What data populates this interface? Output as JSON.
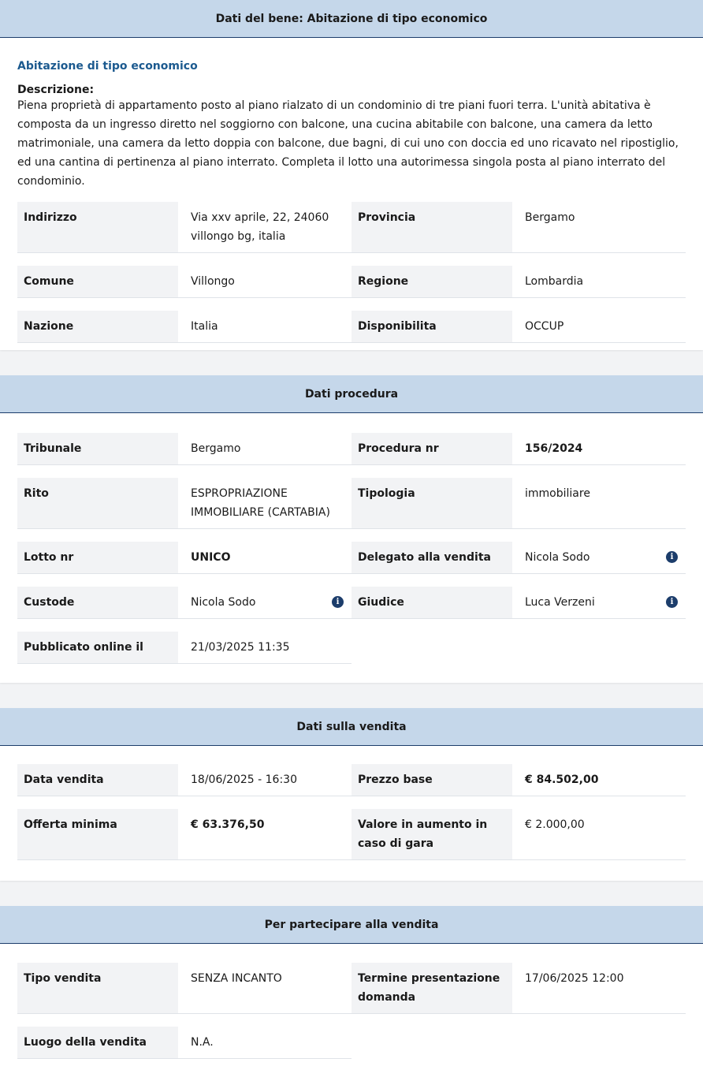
{
  "bene": {
    "header": "Dati del bene: Abitazione di tipo economico",
    "subtitle": "Abitazione di tipo economico",
    "descrizione_label": "Descrizione:",
    "descrizione": "Piena proprietà di appartamento posto al piano rialzato di un condominio di tre piani fuori terra. L'unità abitativa è composta da un ingresso diretto nel soggiorno con balcone, una cucina abitabile con balcone, una camera da letto matrimoniale, una camera da letto doppia con balcone, due bagni, di cui uno con doccia ed uno ricavato nel ripostiglio, ed una cantina di pertinenza al piano interrato. Completa il lotto una autorimessa singola posta al piano interrato del condominio.",
    "indirizzo_label": "Indirizzo",
    "indirizzo": "Via xxv aprile, 22, 24060 villongo bg, italia",
    "provincia_label": "Provincia",
    "provincia": "Bergamo",
    "comune_label": "Comune",
    "comune": "Villongo",
    "regione_label": "Regione",
    "regione": "Lombardia",
    "nazione_label": "Nazione",
    "nazione": "Italia",
    "disponibilita_label": "Disponibilita",
    "disponibilita": "OCCUP"
  },
  "procedura": {
    "header": "Dati procedura",
    "tribunale_label": "Tribunale",
    "tribunale": "Bergamo",
    "procedura_nr_label": "Procedura nr",
    "procedura_nr": "156/2024",
    "rito_label": "Rito",
    "rito": "ESPROPRIAZIONE IMMOBILIARE (CARTABIA)",
    "tipologia_label": "Tipologia",
    "tipologia": "immobiliare",
    "lotto_label": "Lotto nr",
    "lotto": "UNICO",
    "delegato_label": "Delegato alla vendita",
    "delegato": "Nicola Sodo",
    "custode_label": "Custode",
    "custode": "Nicola Sodo",
    "giudice_label": "Giudice",
    "giudice": "Luca Verzeni",
    "pubblicato_label": "Pubblicato online il",
    "pubblicato": "21/03/2025 11:35",
    "info_glyph": "i"
  },
  "vendita": {
    "header": "Dati sulla vendita",
    "data_label": "Data vendita",
    "data": "18/06/2025 - 16:30",
    "prezzo_label": "Prezzo base",
    "prezzo": "€ 84.502,00",
    "offerta_label": "Offerta minima",
    "offerta": "€ 63.376,50",
    "aumento_label": "Valore in aumento in caso di gara",
    "aumento": "€ 2.000,00"
  },
  "partecipare": {
    "header": "Per partecipare alla vendita",
    "tipo_label": "Tipo vendita",
    "tipo": "SENZA INCANTO",
    "termine_label": "Termine presentazione domanda",
    "termine": "17/06/2025 12:00",
    "luogo_label": "Luogo della vendita",
    "luogo": "N.A."
  },
  "icons": {
    "info": "info-circle-icon",
    "info_color": "#1c3d6b"
  }
}
